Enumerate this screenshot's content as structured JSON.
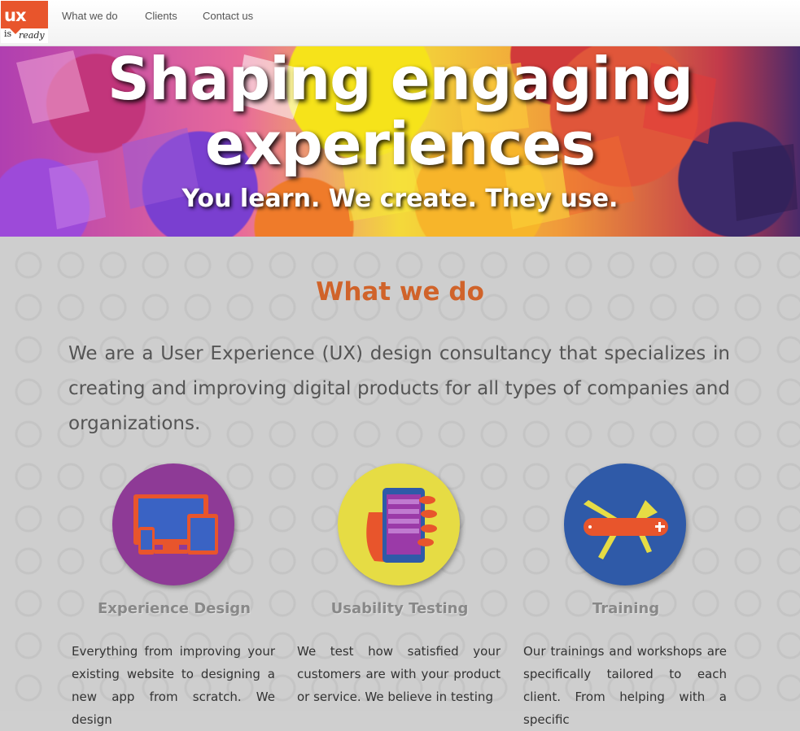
{
  "logo": {
    "top": "ux",
    "bottom_left": "is",
    "bottom_right": "ready"
  },
  "nav": {
    "items": [
      {
        "label": "What we do"
      },
      {
        "label": "Clients"
      },
      {
        "label": "Contact us"
      }
    ]
  },
  "hero": {
    "title_line1": "Shaping engaging",
    "title_line2": "experiences",
    "subtitle": "You learn. We create. They use."
  },
  "section": {
    "title": "What we do",
    "intro": "We are a User Experience (UX) design consultancy that specializes in creating and improving digital products for all types of companies and organizations."
  },
  "services": [
    {
      "title": "Experience Design",
      "text": "Everything from improving your existing website to designing a new app from scratch. We design",
      "color": "#8e3a96",
      "icon": "devices-icon"
    },
    {
      "title": "Usability Testing",
      "text": "We test how satisfied your customers are with your product or service. We believe in testing",
      "color": "#e6dc44",
      "icon": "phone-in-hand-icon"
    },
    {
      "title": "Training",
      "text": "Our trainings and workshops are specifically tailored to each client. From helping with a specific",
      "color": "#2f5aa8",
      "icon": "swiss-knife-icon"
    }
  ],
  "colors": {
    "accent": "#d0632a",
    "brand": "#e8552c"
  }
}
